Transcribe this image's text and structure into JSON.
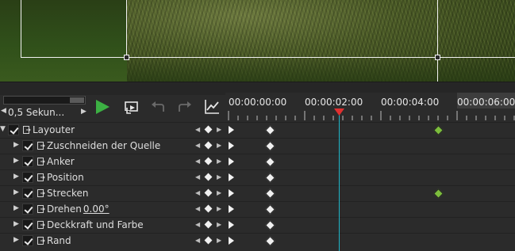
{
  "toolbar": {
    "zoom_value": "0,5 Sekun...",
    "zoom_prev_icon": "triangle-left",
    "zoom_next_icon": "triangle-right",
    "buttons": [
      "play-icon",
      "loop-preview-icon",
      "undo-icon",
      "redo-icon",
      "graph-icon"
    ]
  },
  "ruler": {
    "timecodes": [
      "00:00:00:00",
      "00:00:02:00",
      "00:00:04:00",
      "00:00:06:00"
    ]
  },
  "colors": {
    "accent": "#3cb043",
    "keyframe_white": "#f0f0f0",
    "keyframe_green": "#7cbd3c",
    "playhead": "#1fb6c8",
    "playhead_marker": "#e03030"
  },
  "tracks": [
    {
      "name": "Layouter",
      "value": "",
      "level": 0,
      "keyframes": [
        "white",
        "green"
      ]
    },
    {
      "name": "Zuschneiden der Quelle",
      "value": "",
      "level": 1,
      "keyframes": [
        "white"
      ]
    },
    {
      "name": "Anker",
      "value": "",
      "level": 1,
      "keyframes": [
        "white"
      ]
    },
    {
      "name": "Position",
      "value": "",
      "level": 1,
      "keyframes": [
        "white"
      ]
    },
    {
      "name": "Strecken",
      "value": "",
      "level": 1,
      "keyframes": [
        "white",
        "green"
      ]
    },
    {
      "name": "Drehen",
      "value": "0.00°",
      "level": 1,
      "keyframes": [
        "white"
      ]
    },
    {
      "name": "Deckkraft und Farbe",
      "value": "",
      "level": 1,
      "keyframes": [
        "white"
      ]
    },
    {
      "name": "Rand",
      "value": "",
      "level": 1,
      "keyframes": [
        "white"
      ]
    }
  ]
}
